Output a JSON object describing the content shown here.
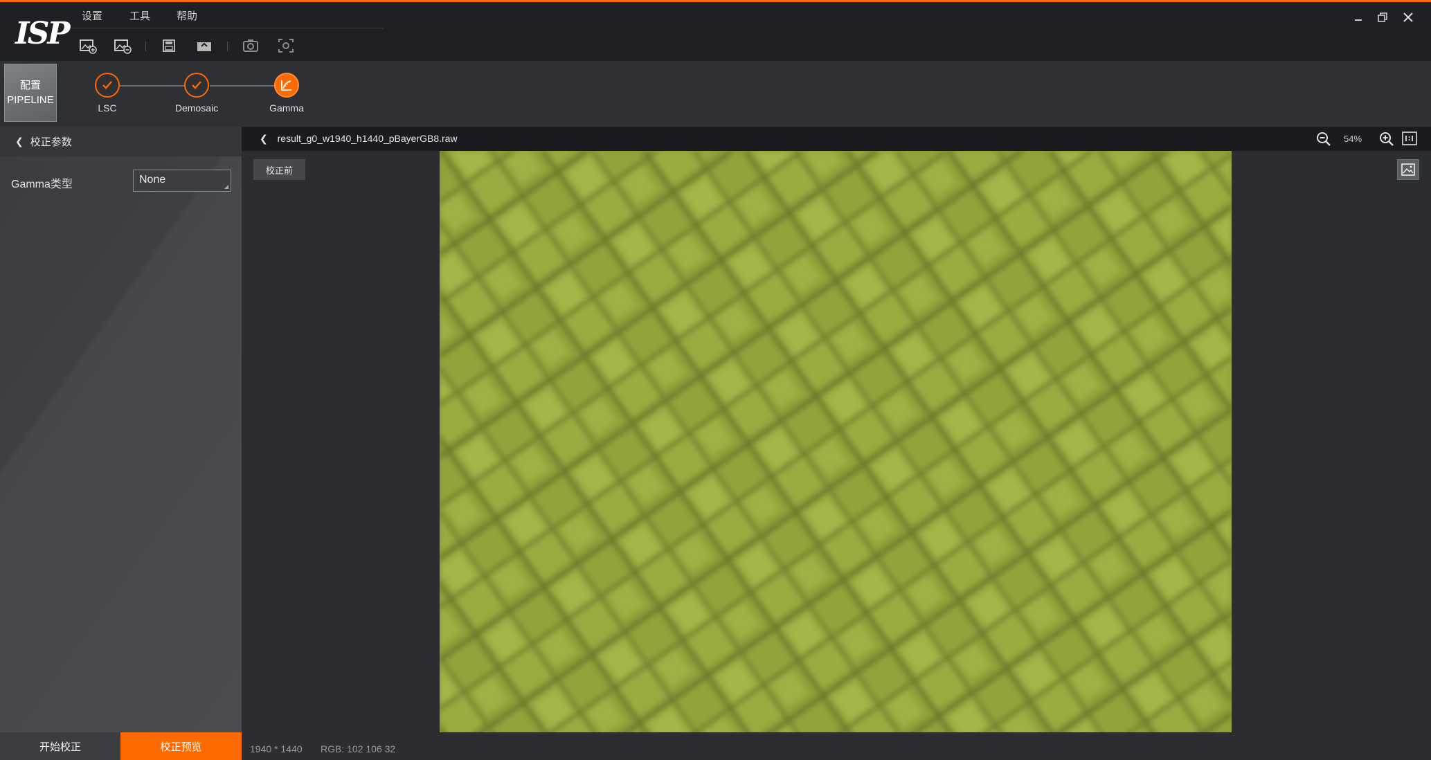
{
  "app": {
    "logo_text": "ISP"
  },
  "menu": [
    {
      "label": "设置"
    },
    {
      "label": "工具"
    },
    {
      "label": "帮助"
    }
  ],
  "toolbar_icons": [
    "open-image-icon",
    "open-folder-image-icon",
    "save-icon",
    "export-icon",
    "camera-icon",
    "capture-icon"
  ],
  "pipeline": {
    "config_button": {
      "line1": "配置",
      "line2": "PIPELINE"
    },
    "steps": [
      {
        "label": "LSC",
        "state": "done"
      },
      {
        "label": "Demosaic",
        "state": "done"
      },
      {
        "label": "Gamma",
        "state": "active"
      }
    ]
  },
  "left_panel": {
    "header": "校正参数",
    "params": [
      {
        "label": "Gamma类型",
        "value": "None"
      }
    ],
    "buttons": {
      "start": "开始校正",
      "preview": "校正预览"
    }
  },
  "viewer": {
    "file_name": "result_g0_w1940_h1440_pBayerGB8.raw",
    "zoom": "54%",
    "before_button": "校正前",
    "status": {
      "resolution": "1940 * 1440",
      "rgb": "RGB: 102 106 32"
    }
  },
  "colors": {
    "accent": "#ff6a00",
    "image_base": "#8a9a35",
    "image_light": "#a9b84a",
    "image_dark": "#5f6e22"
  }
}
